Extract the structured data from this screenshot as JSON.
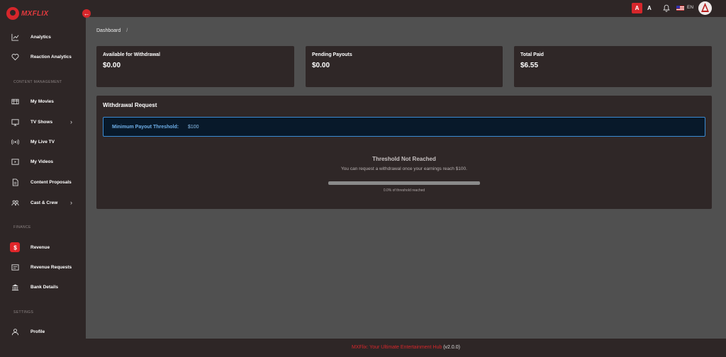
{
  "brand": {
    "name": "MXFLIX",
    "accent": "#d6262b"
  },
  "sidebar": {
    "items_top": [
      {
        "label": "Analytics",
        "icon": "chart-icon"
      },
      {
        "label": "Reaction Analytics",
        "icon": "heart-icon"
      }
    ],
    "sections": [
      {
        "label": "CONTENT MANAGEMENT"
      },
      {
        "label": "FINANCE"
      },
      {
        "label": "SETTINGS"
      }
    ],
    "content": [
      {
        "label": "My Movies",
        "icon": "film-icon"
      },
      {
        "label": "TV Shows",
        "icon": "tv-icon"
      },
      {
        "label": "My Live TV",
        "icon": "broadcast-icon"
      },
      {
        "label": "My Videos",
        "icon": "video-icon"
      },
      {
        "label": "Content Proposals",
        "icon": "document-icon"
      },
      {
        "label": "Cast & Crew",
        "icon": "people-icon"
      }
    ],
    "finance": [
      {
        "label": "Revenue",
        "icon": "dollar-icon"
      },
      {
        "label": "Revenue Requests",
        "icon": "list-icon"
      },
      {
        "label": "Bank Details",
        "icon": "bank-icon"
      }
    ],
    "settings": [
      {
        "label": "Profile",
        "icon": "user-icon"
      }
    ]
  },
  "topbar": {
    "font_a_active": "A",
    "font_a_plain": "A",
    "language": "EN"
  },
  "breadcrumb": {
    "current": "Dashboard",
    "separator": "/"
  },
  "stats": [
    {
      "title": "Available for Withdrawal",
      "value": "$0.00"
    },
    {
      "title": "Pending Payouts",
      "value": "$0.00"
    },
    {
      "title": "Total Paid",
      "value": "$6.55"
    }
  ],
  "withdrawal": {
    "title": "Withdrawal Request",
    "threshold_label": "Minimum Payout Threshold:",
    "threshold_value": "$100",
    "status_title": "Threshold Not Reached",
    "status_desc": "You can request a withdrawal once your earnings reach $100.",
    "progress_fraction": 0.0,
    "progress_text": "0.0% of threshold reached"
  },
  "footer": {
    "brand_text": "MXFlix: Your Ultimate Entertainment Hub",
    "version": "(v2.0.0)"
  }
}
